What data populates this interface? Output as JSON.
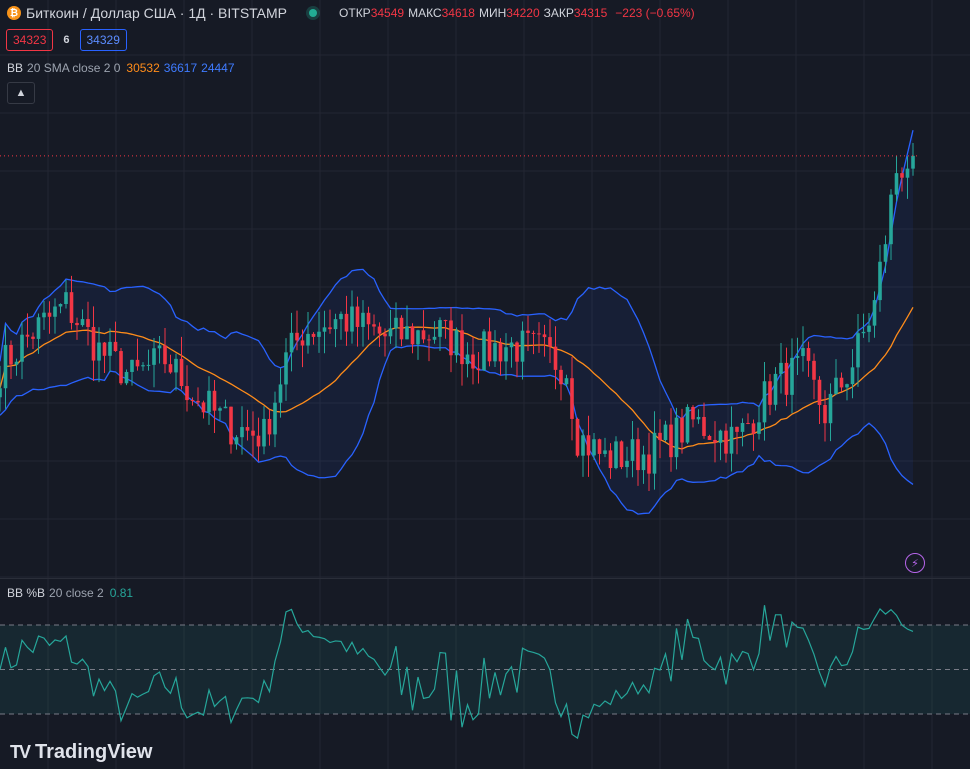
{
  "header": {
    "coin_icon": "₿",
    "title": "Биткоин / Доллар США · 1Д · BITSTAMP",
    "status_color": "#22ab94",
    "open_label": "ОТКР",
    "open": "34549",
    "high_label": "МАКС",
    "high": "34618",
    "low_label": "МИН",
    "low": "34220",
    "close_label": "ЗАКР",
    "close": "34315",
    "change": "−223 (−0.65%)"
  },
  "quote": {
    "sell": "34323",
    "spread": "6",
    "buy": "34329"
  },
  "indicators": {
    "bb": {
      "name": "BB",
      "params": "20 SMA close 2 0",
      "basis": "30532",
      "upper": "36617",
      "lower": "24447"
    },
    "pctb": {
      "name": "BB %B",
      "params": "20 close 2",
      "value": "0.81"
    }
  },
  "icons": {
    "collapse": "chevron-up-icon",
    "bolt": "lightning-icon",
    "brand": "tradingview-logo-icon"
  },
  "brand": {
    "logo": "TV",
    "name": "TradingView"
  },
  "colors": {
    "up": "#26a69a",
    "down": "#f23645",
    "basis": "#ff8c1a",
    "bands": "#2962ff",
    "pctb": "#26a69a"
  },
  "chart_data": [
    {
      "type": "candlestick",
      "title": "Биткоин / Доллар США · 1Д · BITSTAMP",
      "grid": true,
      "last_close": 34315,
      "anchors": [
        [
          0,
          29600
        ],
        [
          6,
          30400
        ],
        [
          12,
          31000
        ],
        [
          18,
          30000
        ],
        [
          24,
          29400
        ],
        [
          30,
          29800
        ],
        [
          36,
          28900
        ],
        [
          42,
          28300
        ],
        [
          48,
          28100
        ],
        [
          52,
          29800
        ],
        [
          55,
          30400
        ],
        [
          62,
          30700
        ],
        [
          70,
          30300
        ],
        [
          80,
          30400
        ],
        [
          86,
          29900
        ],
        [
          92,
          30100
        ],
        [
          98,
          30000
        ],
        [
          103,
          29600
        ],
        [
          105,
          28100
        ],
        [
          110,
          27600
        ],
        [
          118,
          27700
        ],
        [
          126,
          28400
        ],
        [
          134,
          28000
        ],
        [
          141,
          29300
        ],
        [
          146,
          29600
        ],
        [
          150,
          28600
        ],
        [
          155,
          29700
        ],
        [
          159,
          31000
        ],
        [
          163,
          34000
        ],
        [
          166,
          34300
        ]
      ],
      "candle_count": 167
    },
    {
      "type": "line",
      "name": "BB %B",
      "y_levels": [
        1,
        0.5,
        0
      ],
      "last_value": 0.81
    }
  ]
}
